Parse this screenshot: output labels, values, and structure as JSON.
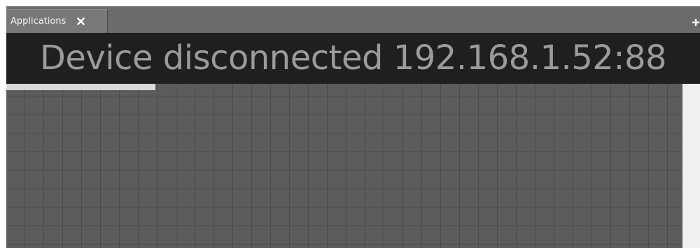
{
  "tabs": [
    {
      "label": "Applications",
      "active": true
    }
  ],
  "icons": {
    "tab_close": "close-icon",
    "add_tab": "plus-icon"
  },
  "banner": {
    "message": "Device disconnected 192.168.1.52:88"
  },
  "progress": {
    "fraction": 0.22
  },
  "colors": {
    "tab_bar": "#6b6b6b",
    "tab_active": "#787878",
    "banner_bg": "#1f1f1f",
    "banner_text": "#9b9b9b",
    "grid_bg": "#5c5c5c",
    "grid_lines": "#4b4b4b",
    "progress_fill": "#d8d8d8",
    "scrollbar": "#f0f0f0"
  }
}
